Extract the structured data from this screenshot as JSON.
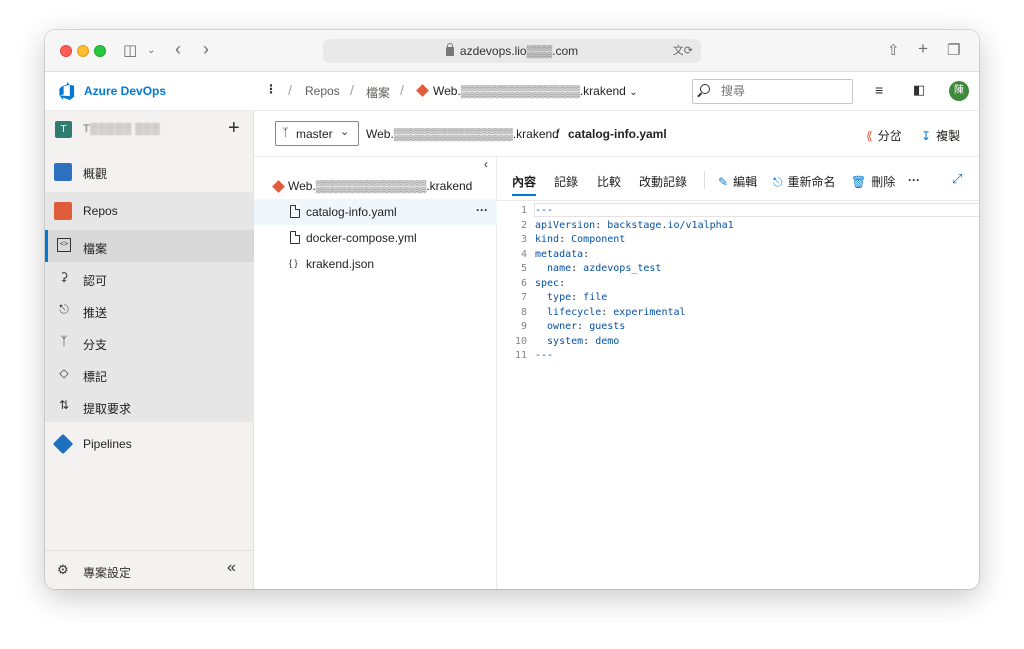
{
  "browser": {
    "url": "azdevops.lio▒▒▒.com",
    "translate_icon": "translate-icon",
    "reload_icon": "reload-icon"
  },
  "header": {
    "brand": "Azure DevOps",
    "breadcrumb": [
      "Repos",
      "檔案"
    ],
    "repo_name": "Web.▒▒▒▒▒▒▒▒▒▒▒▒▒▒.krakend",
    "search_placeholder": "搜尋",
    "avatar_initial": "陳"
  },
  "sidebar": {
    "project_badge": "T",
    "project_name": "T▒▒▒▒▒ ▒▒▒",
    "items": [
      {
        "label": "概觀"
      },
      {
        "label": "Repos"
      },
      {
        "label": "檔案"
      },
      {
        "label": "認可"
      },
      {
        "label": "推送"
      },
      {
        "label": "分支"
      },
      {
        "label": "標記"
      },
      {
        "label": "提取要求"
      },
      {
        "label": "Pipelines"
      }
    ],
    "settings_label": "專案設定"
  },
  "toolbar": {
    "branch": "master",
    "path_repo": "Web.▒▒▒▒▒▒▒▒▒▒▒▒▒▒.krakend",
    "path_file": "catalog-info.yaml",
    "fork_label": "分岔",
    "clone_label": "複製"
  },
  "tree": {
    "root": "Web.▒▒▒▒▒▒▒▒▒▒▒▒▒.krakend",
    "files": [
      "catalog-info.yaml",
      "docker-compose.yml",
      "krakend.json"
    ],
    "more": "···"
  },
  "tabs": [
    "內容",
    "記錄",
    "比較",
    "改動記錄"
  ],
  "actions": {
    "edit": "編輯",
    "rename": "重新命名",
    "delete": "刪除",
    "more": "···"
  },
  "code": [
    {
      "n": "1",
      "key": "",
      "sep": "",
      "val": "---"
    },
    {
      "n": "2",
      "key": "apiVersion",
      "sep": ": ",
      "val": "backstage.io/v1alpha1"
    },
    {
      "n": "3",
      "key": "kind",
      "sep": ": ",
      "val": "Component"
    },
    {
      "n": "4",
      "key": "metadata",
      "sep": ":",
      "val": ""
    },
    {
      "n": "5",
      "key": "  name",
      "sep": ": ",
      "val": "azdevops_test"
    },
    {
      "n": "6",
      "key": "spec",
      "sep": ":",
      "val": ""
    },
    {
      "n": "7",
      "key": "  type",
      "sep": ": ",
      "val": "file"
    },
    {
      "n": "8",
      "key": "  lifecycle",
      "sep": ": ",
      "val": "experimental"
    },
    {
      "n": "9",
      "key": "  owner",
      "sep": ": ",
      "val": "guests"
    },
    {
      "n": "10",
      "key": "  system",
      "sep": ": ",
      "val": "demo"
    },
    {
      "n": "11",
      "key": "",
      "sep": "",
      "val": "---"
    }
  ]
}
